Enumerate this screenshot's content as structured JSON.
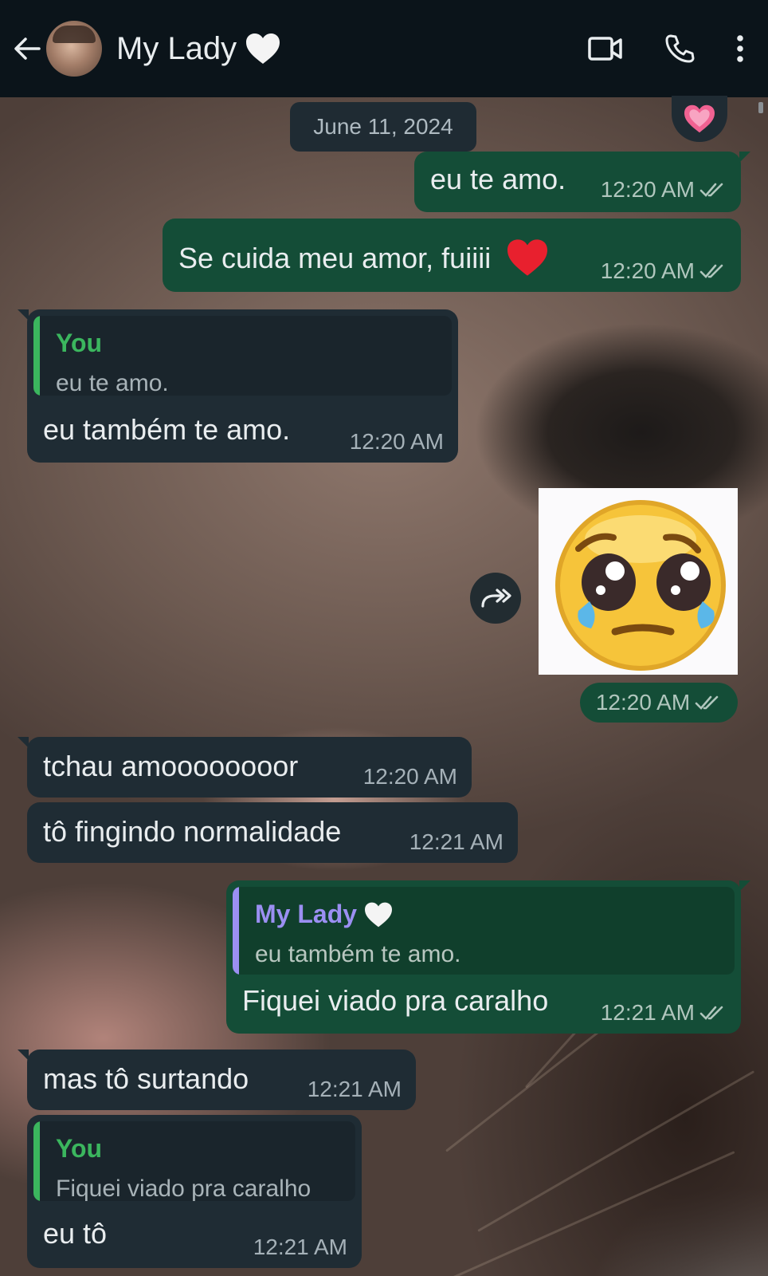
{
  "header": {
    "contact_name": "My Lady",
    "back_icon": "arrow-left-icon",
    "avatar": "contact-avatar",
    "name_emoji": "white-heart-icon",
    "actions": [
      "video-call-icon",
      "voice-call-icon",
      "more-options-icon"
    ]
  },
  "date_separator": "June 11, 2024",
  "reaction": "pink-heart-icon",
  "colors": {
    "header_bg": "#0b141a",
    "outgoing_bubble": "#144d37",
    "incoming_bubble": "#1f2c34",
    "quote_you_name": "#3bb65e",
    "quote_lady_name": "#9b8ff2",
    "read_tick": "#b0c6bd"
  },
  "messages": [
    {
      "text": "eu te amo.",
      "time": "12:20 AM"
    },
    {
      "text": "Se cuida meu amor, fuiiii",
      "time": "12:20 AM"
    },
    {
      "quote_name": "You",
      "quote_text": "eu te amo.",
      "text": "eu também te amo.",
      "time": "12:20 AM"
    },
    {
      "time": "12:20 AM"
    },
    {
      "text": "tchau amoooooooor",
      "time": "12:20 AM"
    },
    {
      "text": "tô fingindo normalidade",
      "time": "12:21 AM"
    },
    {
      "quote_name": "My Lady",
      "quote_text": "eu também te amo.",
      "text": "Fiquei viado pra caralho",
      "time": "12:21 AM"
    },
    {
      "text": "mas tô surtando",
      "time": "12:21 AM"
    },
    {
      "quote_name": "You",
      "quote_text": "Fiquei viado pra caralho",
      "text": "eu tô",
      "time": "12:21 AM"
    }
  ]
}
